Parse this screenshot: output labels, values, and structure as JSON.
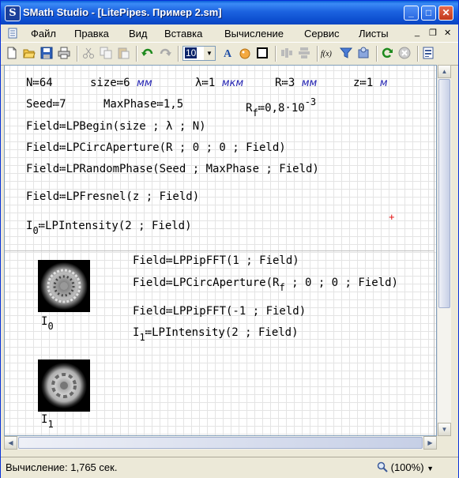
{
  "window": {
    "title": "SMath Studio - [LitePipes. Пример 2.sm]",
    "app_icon_letter": "S"
  },
  "menu": {
    "items": [
      "Файл",
      "Правка",
      "Вид",
      "Вставка",
      "Вычисление",
      "Сервис",
      "Листы"
    ]
  },
  "toolbar": {
    "font_size": "10",
    "function_icon_label": "f(x)"
  },
  "sheet": {
    "row1": {
      "N": "N≔64",
      "size": "size≔6",
      "size_unit": "мм",
      "lambda": "λ≔1",
      "lambda_unit": "мкм",
      "R": "R≔3",
      "R_unit": "мм",
      "z": "z≔1",
      "z_unit": "м"
    },
    "row2": {
      "seed": "Seed≔7",
      "maxphase": "MaxPhase≔1,5",
      "rf_name": "R",
      "rf_sub": "f",
      "rf_value": "≔0,8·10",
      "rf_exp": "-3"
    },
    "lines": [
      "Field≔LPBegin(size ; λ ; N)",
      "Field≔LPCircAperture(R ; 0 ; 0 ; Field)",
      "Field≔LPRandomPhase(Seed ; MaxPhase ; Field)",
      "Field≔LPFresnel(z ; Field)"
    ],
    "intensity0": {
      "name": "I",
      "sub": "0",
      "expr": "≔LPIntensity(2 ; Field)"
    },
    "right_block": [
      "Field≔LPPipFFT(1 ; Field)",
      "Field≔LPCircAperture(R",
      "Field≔LPPipFFT(-1 ; Field)"
    ],
    "circ_rest": " ; 0 ; 0 ; Field)",
    "circ_sub": "f",
    "intensity1": {
      "name": "I",
      "sub": "1",
      "expr": "≔LPIntensity(2 ; Field)"
    },
    "image_labels": [
      {
        "name": "I",
        "sub": "0"
      },
      {
        "name": "I",
        "sub": "1"
      }
    ]
  },
  "status": {
    "text": "Вычисление: 1,765 сек.",
    "zoom": "(100%)"
  }
}
